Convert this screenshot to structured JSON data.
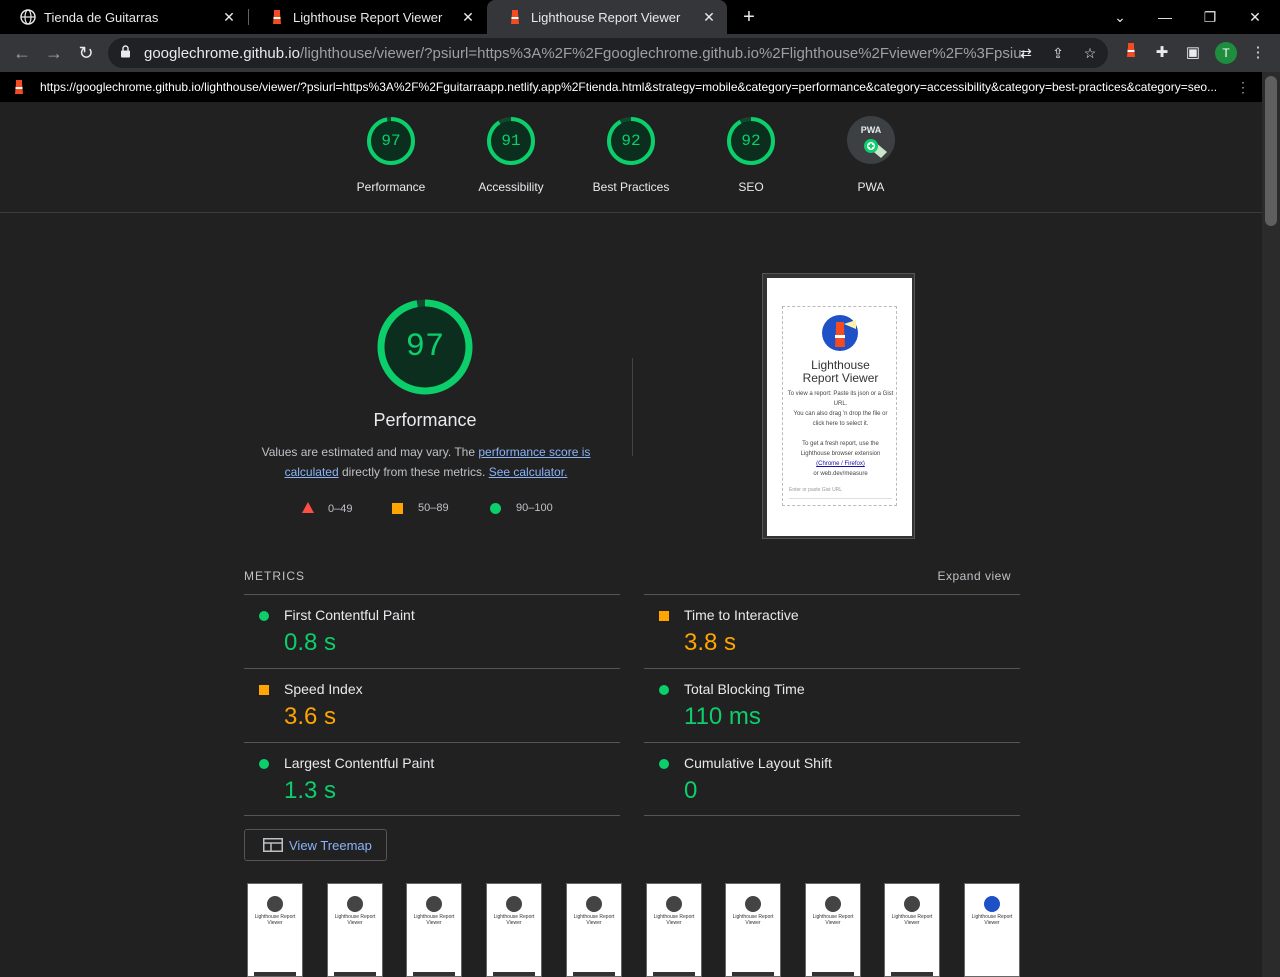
{
  "browser": {
    "tabs": [
      {
        "title": "Tienda de Guitarras",
        "icon": "globe-icon"
      },
      {
        "title": "Lighthouse Report Viewer",
        "icon": "lighthouse-icon"
      },
      {
        "title": "Lighthouse Report Viewer",
        "icon": "lighthouse-icon",
        "active": true
      }
    ],
    "address": {
      "host": "googlechrome.github.io",
      "path": "/lighthouse/viewer/?psiurl=https%3A%2F%2Fgooglechrome.github.io%2Flighthouse%2Fviewer%2F%3Fpsiurl%3D..."
    },
    "profile_initial": "T"
  },
  "report": {
    "url": "https://googlechrome.github.io/lighthouse/viewer/?psiurl=https%3A%2F%2Fguitarraapp.netlify.app%2Ftienda.html&strategy=mobile&category=performance&category=accessibility&category=best-practices&category=seo..."
  },
  "gauges": [
    {
      "label": "Performance",
      "score": "97",
      "value": 0.97
    },
    {
      "label": "Accessibility",
      "score": "91",
      "value": 0.91
    },
    {
      "label": "Best Practices",
      "score": "92",
      "value": 0.92
    },
    {
      "label": "SEO",
      "score": "92",
      "value": 0.92
    },
    {
      "label": "PWA",
      "score": "PWA"
    }
  ],
  "performance": {
    "score": "97",
    "value": 0.97,
    "title": "Performance",
    "desc_pre": "Values are estimated and may vary. The ",
    "desc_link1": "performance score is calculated",
    "desc_mid": " directly from these metrics. ",
    "desc_link2": "See calculator."
  },
  "legend": [
    {
      "range": "0–49",
      "shape": "triangle",
      "color": "#ff4e42"
    },
    {
      "range": "50–89",
      "shape": "square",
      "color": "#ffa400"
    },
    {
      "range": "90–100",
      "shape": "circle",
      "color": "#0cce6b"
    }
  ],
  "screenshot": {
    "title_line1": "Lighthouse",
    "title_line2": "Report Viewer",
    "line1": "To view a report: Paste its json or a Gist URL.",
    "line2": "You can also drag 'n drop the file or click here to select it.",
    "line3": "To get a fresh report, use the Lighthouse browser extension",
    "line4": "(Chrome / Firefox)",
    "line5": "or web.dev/measure",
    "input_placeholder": "Enter or paste Gist URL"
  },
  "metrics": {
    "header": "METRICS",
    "expand": "Expand view",
    "items": [
      {
        "title": "First Contentful Paint",
        "value": "0.8 s",
        "rating": "good"
      },
      {
        "title": "Time to Interactive",
        "value": "3.8 s",
        "rating": "average"
      },
      {
        "title": "Speed Index",
        "value": "3.6 s",
        "rating": "average"
      },
      {
        "title": "Total Blocking Time",
        "value": "110 ms",
        "rating": "good"
      },
      {
        "title": "Largest Contentful Paint",
        "value": "1.3 s",
        "rating": "good"
      },
      {
        "title": "Cumulative Layout Shift",
        "value": "0",
        "rating": "good"
      }
    ]
  },
  "treemap_label": "View Treemap",
  "filmstrip_title": "Lighthouse Report Viewer",
  "colors": {
    "good": "#0cce6b",
    "average": "#ffa400",
    "fail": "#ff4e42",
    "link": "#8ab4f8"
  }
}
